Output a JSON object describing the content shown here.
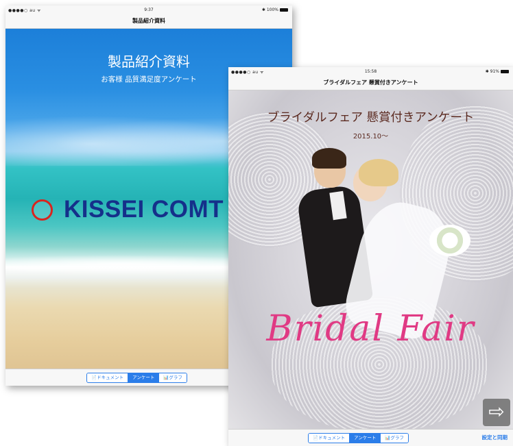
{
  "device1": {
    "status": {
      "carrier": "●●●●○ au ᯤ",
      "time": "9:37",
      "battery": "✱ 100%"
    },
    "nav_title": "製品紹介資料",
    "content_title": "製品紹介資料",
    "content_subtitle": "お客様 品質満足度アンケート",
    "logo_text": "KISSEI COMT",
    "logo_mark": "KISSEI",
    "tabs": [
      "📄ドキュメント",
      "アンケート",
      "📊グラフ"
    ],
    "active_tab": 1
  },
  "device2": {
    "status": {
      "carrier": "●●●●○ au ᯤ",
      "time": "15:58",
      "battery": "✱ 91%"
    },
    "nav_title": "ブライダルフェア 懸賞付きアンケート",
    "content_title": "ブライダルフェア 懸賞付きアンケート",
    "content_subtitle": "2015.10～",
    "bridal_text": "Bridal Fair",
    "tabs": [
      "📄ドキュメント",
      "アンケート",
      "📊グラフ"
    ],
    "active_tab": 1,
    "sync_label": "設定と同期",
    "next_icon": "⇨"
  },
  "colors": {
    "accent": "#2b7de9",
    "logo_blue": "#15308a",
    "logo_red": "#d9241e",
    "bridal_pink": "#e03a84",
    "title_brown": "#5b2a20"
  }
}
